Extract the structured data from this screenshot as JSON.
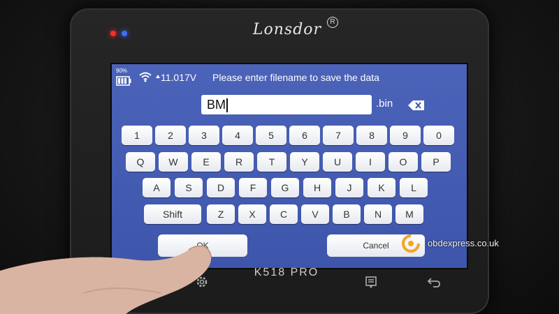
{
  "device": {
    "brand": "Lonsdor",
    "brand_mark": "R",
    "model": "K518 PRO"
  },
  "statusbar": {
    "battery_percent": "90%",
    "battery_icon": "battery-icon",
    "wifi_icon": "wifi-icon",
    "voltage": "11.017V",
    "prompt": "Please enter filename to save the data"
  },
  "filename": {
    "value": "BM",
    "extension": ".bin",
    "backspace_icon": "backspace-icon"
  },
  "keyboard": {
    "row1": [
      "1",
      "2",
      "3",
      "4",
      "5",
      "6",
      "7",
      "8",
      "9",
      "0"
    ],
    "row2": [
      "Q",
      "W",
      "E",
      "R",
      "T",
      "Y",
      "U",
      "I",
      "O",
      "P"
    ],
    "row3": [
      "A",
      "S",
      "D",
      "F",
      "G",
      "H",
      "J",
      "K",
      "L"
    ],
    "row4_shift": "Shift",
    "row4": [
      "Z",
      "X",
      "C",
      "V",
      "B",
      "N",
      "M"
    ]
  },
  "actions": {
    "ok_label": "OK",
    "cancel_label": "Cancel"
  },
  "hardware_nav": {
    "icons": [
      "home-icon",
      "settings-icon",
      "menu-icon",
      "back-icon"
    ]
  },
  "watermark": {
    "text": "obdexpress.co.uk"
  },
  "colors": {
    "screen_bg": "#4b63b8",
    "key_bg": "#ffffff",
    "watermark_accent": "#f5a623"
  }
}
